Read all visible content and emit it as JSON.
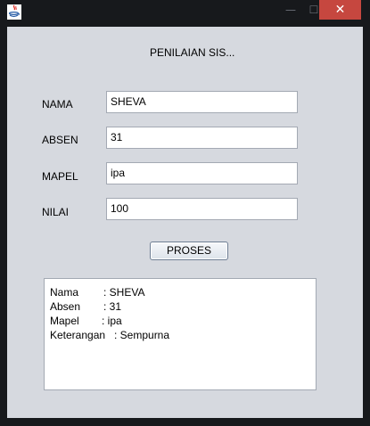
{
  "window": {
    "minimize_glyph": "—",
    "maximize_glyph": "☐",
    "close_glyph": "✕",
    "close_color": "#c6473f",
    "app_icon": "java-icon"
  },
  "form": {
    "title": "PENILAIAN SIS...",
    "fields": [
      {
        "label": "NAMA",
        "value": "SHEVA"
      },
      {
        "label": "ABSEN",
        "value": "31"
      },
      {
        "label": "MAPEL",
        "value": "ipa"
      },
      {
        "label": "NILAI",
        "value": "100"
      }
    ],
    "button_label": "PROSES"
  },
  "output": {
    "lines": [
      {
        "key": "Nama",
        "sep": ": SHEVA"
      },
      {
        "key": "Absen",
        "sep": ": 31"
      },
      {
        "key": "Mapel",
        "sep": ": ipa"
      },
      {
        "key": "Keterangan",
        "sep": ": Sempurna"
      }
    ]
  }
}
